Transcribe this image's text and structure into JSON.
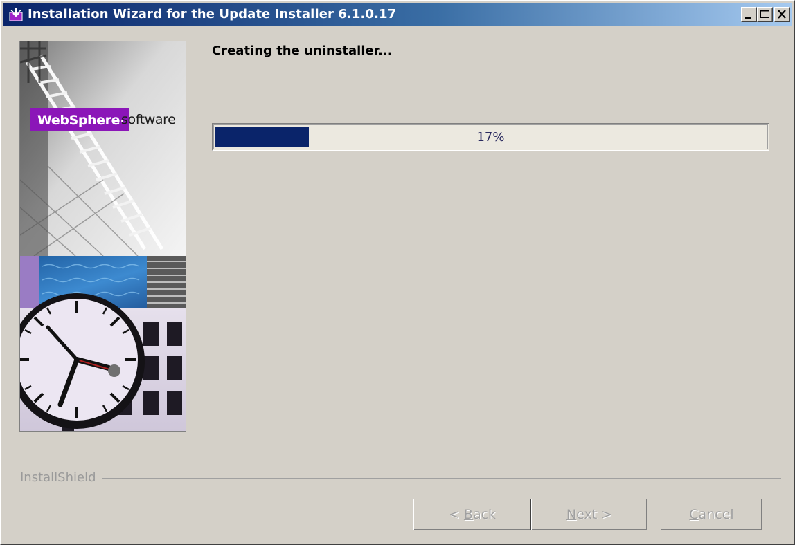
{
  "window": {
    "title": "Installation Wizard for the Update Installer 6.1.0.17"
  },
  "title_bar_buttons": {
    "minimize_icon": "minimize-icon",
    "maximize_icon": "maximize-icon",
    "close_icon": "close-icon"
  },
  "banner": {
    "brand": "WebSphere",
    "brand_mark": ".",
    "product": "software"
  },
  "content": {
    "heading": "Creating the uninstaller...",
    "progress_percent": 17,
    "progress_label": "17%"
  },
  "footer": {
    "brand_label": "InstallShield",
    "back": {
      "prefix": "< ",
      "mnemonic": "B",
      "rest": "ack"
    },
    "next": {
      "mnemonic": "N",
      "rest": "ext >"
    },
    "cancel": {
      "mnemonic": "C",
      "rest": "ancel"
    }
  },
  "colors": {
    "titlebar_start": "#0a246a",
    "titlebar_end": "#a6caf0",
    "progress_fill": "#0a246a",
    "brand_badge": "#8b16b8",
    "window_face": "#d4d0c8"
  }
}
